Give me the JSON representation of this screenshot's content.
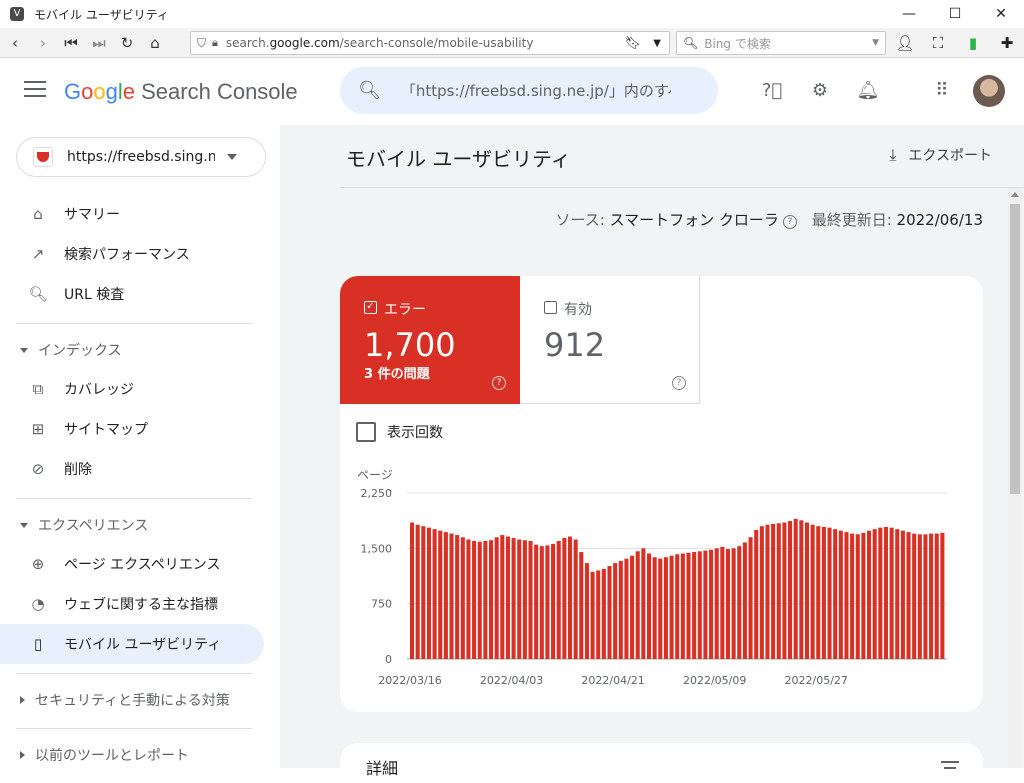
{
  "window": {
    "title": "モバイル ユーザビリティ"
  },
  "browser": {
    "url_prefix": "search.",
    "url_host": "google.com",
    "url_path": "/search-console/mobile-usability",
    "search_placeholder": "Bing で検索"
  },
  "app": {
    "brand": {
      "g": "G",
      "o1": "o",
      "o2": "o",
      "g2": "g",
      "l": "l",
      "e": "e",
      "rest": " Search Console"
    },
    "search_text": "「https://freebsd.sing.ne.jp/」内のすべてのURLを検査"
  },
  "sidebar": {
    "property": "https://freebsd.sing.ne.jp/",
    "items": [
      {
        "label": "サマリー",
        "icon": "home-icon"
      },
      {
        "label": "検索パフォーマンス",
        "icon": "trending-up-icon"
      },
      {
        "label": "URL 検査",
        "icon": "search-icon"
      },
      {
        "label": "カバレッジ",
        "icon": "file-copy-icon"
      },
      {
        "label": "サイトマップ",
        "icon": "sitemap-icon"
      },
      {
        "label": "削除",
        "icon": "visibility-off-icon"
      },
      {
        "label": "ページ エクスペリエンス",
        "icon": "plus-circle-icon"
      },
      {
        "label": "ウェブに関する主な指標",
        "icon": "speed-icon"
      },
      {
        "label": "モバイル ユーザビリティ",
        "icon": "smartphone-icon"
      }
    ],
    "sections": {
      "index": "インデックス",
      "experience": "エクスペリエンス",
      "security": "セキュリティと手動による対策",
      "legacy": "以前のツールとレポート"
    }
  },
  "main": {
    "title": "モバイル ユーザビリティ",
    "export": "エクスポート",
    "source_label": "ソース:",
    "source_value": "スマートフォン クローラ",
    "updated_label": "最終更新日:",
    "updated_value": "2022/06/13",
    "error_tile": {
      "label": "エラー",
      "value": "1,700",
      "sub": "3 件の問題"
    },
    "valid_tile": {
      "label": "有効",
      "value": "912"
    },
    "impressions": "表示回数",
    "details": "詳細"
  },
  "chart_data": {
    "type": "bar",
    "ylabel": "ページ",
    "ylim": [
      0,
      2250
    ],
    "yticks": [
      "0",
      "750",
      "1,500",
      "2,250"
    ],
    "ytick_values": [
      0,
      750,
      1500,
      2250
    ],
    "xticks": [
      "2022/03/16",
      "2022/04/03",
      "2022/04/21",
      "2022/05/09",
      "2022/05/27"
    ],
    "color": "#d93025",
    "start_date": "2022/03/16",
    "values": [
      1850,
      1820,
      1800,
      1780,
      1760,
      1740,
      1720,
      1700,
      1680,
      1650,
      1620,
      1600,
      1590,
      1600,
      1610,
      1650,
      1680,
      1660,
      1640,
      1620,
      1610,
      1600,
      1550,
      1530,
      1540,
      1560,
      1600,
      1640,
      1660,
      1620,
      1450,
      1300,
      1180,
      1200,
      1220,
      1260,
      1300,
      1330,
      1360,
      1400,
      1460,
      1500,
      1430,
      1380,
      1360,
      1380,
      1400,
      1420,
      1430,
      1440,
      1450,
      1460,
      1470,
      1480,
      1500,
      1520,
      1490,
      1500,
      1530,
      1580,
      1650,
      1750,
      1800,
      1820,
      1830,
      1840,
      1850,
      1870,
      1900,
      1880,
      1850,
      1820,
      1800,
      1790,
      1780,
      1760,
      1740,
      1720,
      1700,
      1690,
      1710,
      1740,
      1760,
      1780,
      1790,
      1780,
      1760,
      1740,
      1720,
      1700,
      1690,
      1690,
      1700,
      1700,
      1710
    ],
    "grid": true,
    "legend": "none"
  }
}
